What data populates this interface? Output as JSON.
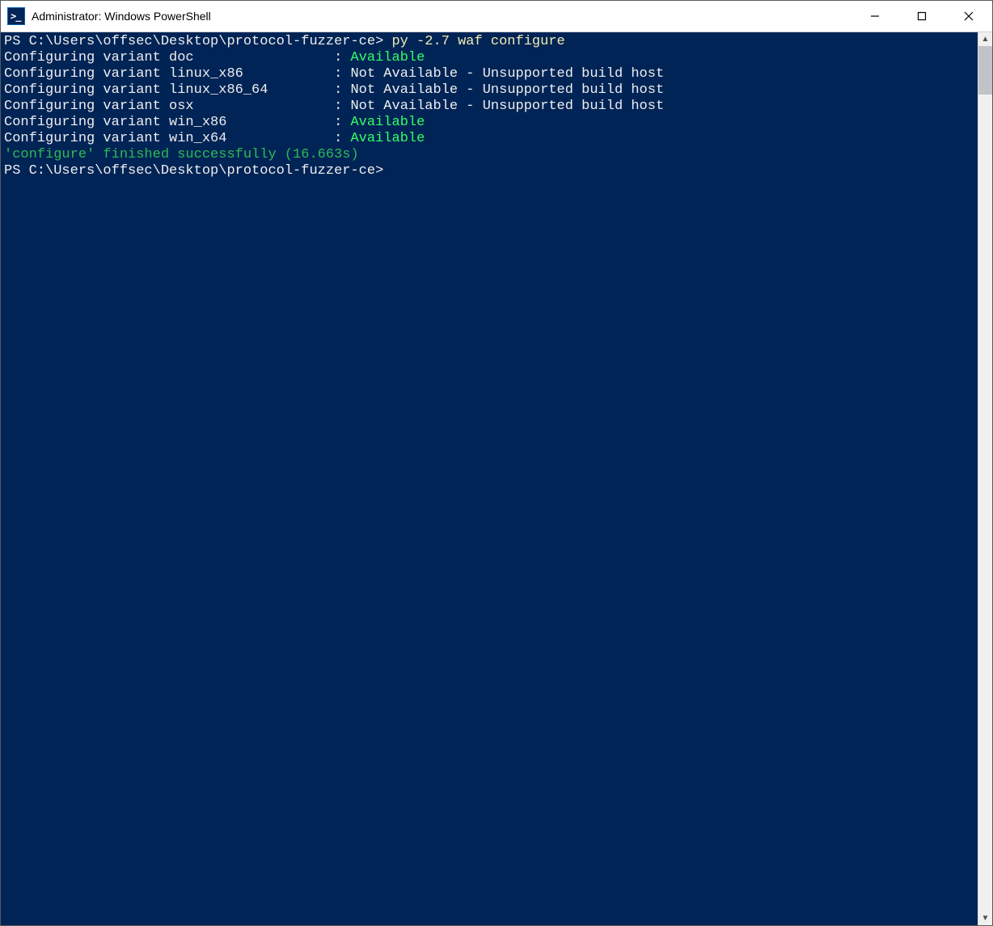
{
  "window": {
    "title": "Administrator: Windows PowerShell"
  },
  "colors": {
    "terminal_bg": "#012456",
    "text_default": "#dcdcdc",
    "text_yellow": "#eeedb3",
    "text_green": "#33ff66",
    "text_green_dim": "#2dbb55"
  },
  "terminal": {
    "prompt1": "PS C:\\Users\\offsec\\Desktop\\protocol-fuzzer-ce>",
    "command": " py -2.7 waf configure",
    "lines": [
      {
        "label": "Configuring variant doc                 : ",
        "status": "Available",
        "status_color": "green"
      },
      {
        "label": "Configuring variant linux_x86           : ",
        "status": "Not Available - Unsupported build host",
        "status_color": "white"
      },
      {
        "label": "Configuring variant linux_x86_64        : ",
        "status": "Not Available - Unsupported build host",
        "status_color": "white"
      },
      {
        "label": "Configuring variant osx                 : ",
        "status": "Not Available - Unsupported build host",
        "status_color": "white"
      },
      {
        "label": "Configuring variant win_x86             : ",
        "status": "Available",
        "status_color": "green"
      },
      {
        "label": "Configuring variant win_x64             : ",
        "status": "Available",
        "status_color": "green"
      }
    ],
    "finish": "'configure' finished successfully (16.663s)",
    "prompt2": "PS C:\\Users\\offsec\\Desktop\\protocol-fuzzer-ce>",
    "cursor": " "
  }
}
